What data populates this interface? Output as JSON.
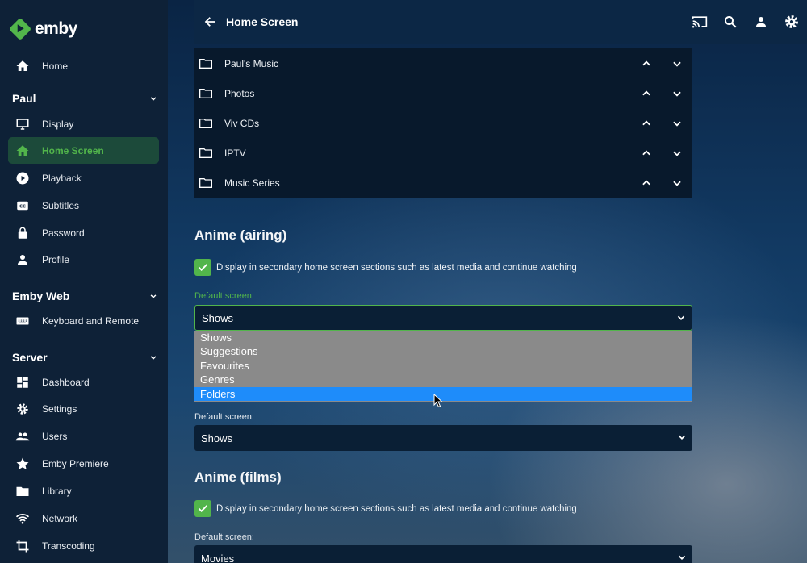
{
  "app": {
    "name": "emby"
  },
  "sidebar": {
    "home": "Home",
    "sections": [
      {
        "title": "Paul",
        "items": [
          "Display",
          "Home Screen",
          "Playback",
          "Subtitles",
          "Password",
          "Profile"
        ]
      },
      {
        "title": "Emby Web",
        "items": [
          "Keyboard and Remote"
        ]
      },
      {
        "title": "Server",
        "items": [
          "Dashboard",
          "Settings",
          "Users",
          "Emby Premiere",
          "Library",
          "Network",
          "Transcoding"
        ]
      }
    ],
    "active": "Home Screen"
  },
  "header": {
    "title": "Home Screen"
  },
  "libraries": [
    "Paul's Music",
    "Photos",
    "Viv CDs",
    "IPTV",
    "Music Series"
  ],
  "anime_airing": {
    "title": "Anime (airing)",
    "checkbox_label": "Display in secondary home screen sections such as latest media and continue watching",
    "default_screen_label": "Default screen:",
    "default_screen_value": "Shows",
    "options": [
      "Shows",
      "Suggestions",
      "Favourites",
      "Genres",
      "Folders"
    ],
    "highlighted_option": "Folders",
    "second_label": "Default screen:",
    "second_value": "Shows"
  },
  "anime_films": {
    "title": "Anime (films)",
    "checkbox_label": "Display in secondary home screen sections such as latest media and continue watching",
    "default_screen_label": "Default screen:",
    "default_screen_value": "Movies"
  },
  "colors": {
    "accent": "#52b54b",
    "highlight": "#1e8cfa",
    "sidebar_bg": "#0e2137"
  }
}
